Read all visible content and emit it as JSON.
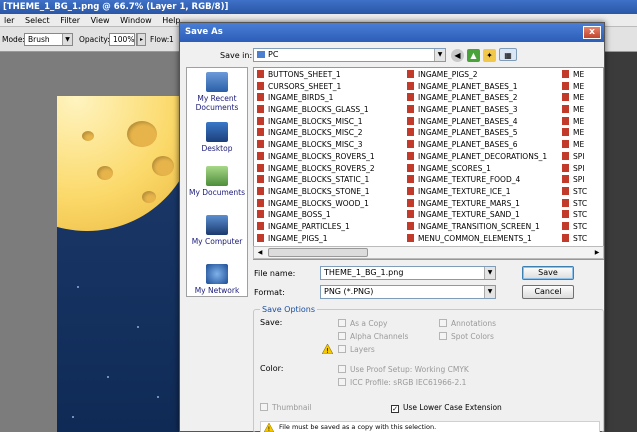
{
  "app": {
    "title": "[THEME_1_BG_1.png @ 66.7% (Layer 1, RGB/8)]",
    "menu": [
      "ler",
      "Select",
      "Filter",
      "View",
      "Window",
      "Help"
    ],
    "options": {
      "mode_label": "Mode:",
      "mode_value": "Brush",
      "opacity_label": "Opacity:",
      "opacity_value": "100%",
      "flow_label": "Flow:",
      "flow_value": "1"
    }
  },
  "dialog": {
    "title": "Save As",
    "close_label": "x",
    "save_in_label": "Save in:",
    "save_in_value": "PC",
    "places": [
      "My Recent Documents",
      "Desktop",
      "My Documents",
      "My Computer",
      "My Network"
    ],
    "files_col1": [
      "BUTTONS_SHEET_1",
      "CURSORS_SHEET_1",
      "INGAME_BIRDS_1",
      "INGAME_BLOCKS_GLASS_1",
      "INGAME_BLOCKS_MISC_1",
      "INGAME_BLOCKS_MISC_2",
      "INGAME_BLOCKS_MISC_3",
      "INGAME_BLOCKS_ROVERS_1",
      "INGAME_BLOCKS_ROVERS_2",
      "INGAME_BLOCKS_STATIC_1",
      "INGAME_BLOCKS_STONE_1",
      "INGAME_BLOCKS_WOOD_1",
      "INGAME_BOSS_1",
      "INGAME_PARTICLES_1",
      "INGAME_PIGS_1"
    ],
    "files_col2": [
      "INGAME_PIGS_2",
      "INGAME_PLANET_BASES_1",
      "INGAME_PLANET_BASES_2",
      "INGAME_PLANET_BASES_3",
      "INGAME_PLANET_BASES_4",
      "INGAME_PLANET_BASES_5",
      "INGAME_PLANET_BASES_6",
      "INGAME_PLANET_DECORATIONS_1",
      "INGAME_SCORES_1",
      "INGAME_TEXTURE_FOOD_4",
      "INGAME_TEXTURE_ICE_1",
      "INGAME_TEXTURE_MARS_1",
      "INGAME_TEXTURE_SAND_1",
      "INGAME_TRANSITION_SCREEN_1",
      "MENU_COMMON_ELEMENTS_1"
    ],
    "files_col3": [
      "ME",
      "ME",
      "ME",
      "ME",
      "ME",
      "ME",
      "ME",
      "SPI",
      "SPI",
      "SPI",
      "STC",
      "STC",
      "STC",
      "STC",
      "STC"
    ],
    "filename_label": "File name:",
    "filename_value": "THEME_1_BG_1.png",
    "format_label": "Format:",
    "format_value": "PNG (*.PNG)",
    "save_button": "Save",
    "cancel_button": "Cancel",
    "save_options_title": "Save Options",
    "save_label": "Save:",
    "as_copy": "As a Copy",
    "alpha_channels": "Alpha Channels",
    "layers": "Layers",
    "annotations": "Annotations",
    "spot_colors": "Spot Colors",
    "color_label": "Color:",
    "use_proof": "Use Proof Setup:  Working CMYK",
    "icc_profile": "ICC Profile:  sRGB IEC61966-2.1",
    "thumbnail": "Thumbnail",
    "lowercase_ext": "Use Lower Case Extension",
    "warning_text": "File must be saved as a copy with this selection."
  }
}
